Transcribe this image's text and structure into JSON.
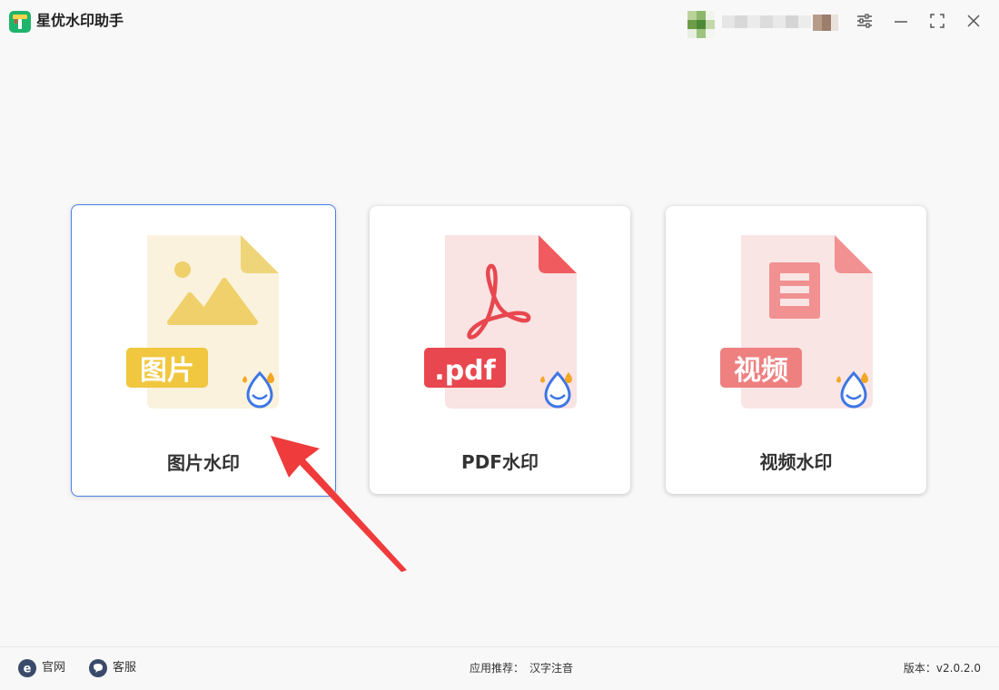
{
  "app": {
    "title": "星优水印助手"
  },
  "window_controls": {
    "icons": [
      "settings-sliders-icon",
      "minimize-icon",
      "maximize-icon",
      "close-icon"
    ]
  },
  "cards": [
    {
      "label": "图片水印",
      "badge": "图片",
      "accent": "#f0c73f",
      "bg": "#faf2dc",
      "fold": "#efd57a",
      "selected": true
    },
    {
      "label": "PDF水印",
      "badge": ".pdf",
      "accent": "#e8474f",
      "bg": "#f9e3e3",
      "fold": "#ef5b5f",
      "selected": false
    },
    {
      "label": "视频水印",
      "badge": "视频",
      "accent": "#ee8080",
      "bg": "#fae5e5",
      "fold": "#f29191",
      "selected": false
    }
  ],
  "colors": {
    "selection_border": "#4a7ee8",
    "arrow": "#ef3b3b",
    "drop_icon": "#3d76e6"
  },
  "footer": {
    "website": "官网",
    "support": "客服",
    "recommend_label": "应用推荐：",
    "recommend_app": "汉字注音",
    "version": "版本：v2.0.2.0"
  }
}
